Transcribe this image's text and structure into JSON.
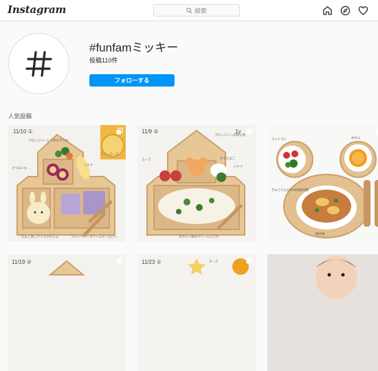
{
  "app": {
    "logo": "Instagram"
  },
  "search": {
    "placeholder": "検索"
  },
  "nav": {
    "icons": [
      "home-icon",
      "explore-icon",
      "heart-icon"
    ]
  },
  "hashtag": {
    "symbol": "#",
    "title": "#funfamミッキー",
    "post_count": "投稿110件",
    "follow_label": "フォローする"
  },
  "section": {
    "top_posts_label": "人気投稿"
  },
  "posts": [
    {
      "date": "11/10 ①",
      "notes": [
        "ブロッコリーと人参のサラダ",
        "さつまいも",
        "バナナ",
        "コーンスープ",
        "サツマイモ",
        "ミッキーパン",
        "たまご蒸しパンうさちゃん",
        "ブルーベリークリームチーズパン"
      ]
    },
    {
      "date": "11/9 ③",
      "notes": [
        "1y",
        "ブロッコリーの和え物",
        "スープ",
        "ゆでたまご",
        "ウインナー",
        "ホウレン草のクリームパスタ",
        "ミッキーライス",
        "バナナ"
      ]
    },
    {
      "date": "",
      "notes": [
        "ミニトマト",
        "みかん",
        "きゅうりとわかめの酢の物",
        "親子丼"
      ]
    },
    {
      "date": "11/19 ②",
      "notes": []
    },
    {
      "date": "11/23 ①",
      "notes": [
        "チーズ"
      ]
    },
    {
      "date": "",
      "notes": []
    }
  ],
  "colors": {
    "accent": "#0095f6",
    "border": "#dbdbdb",
    "muted": "#8e8e8e"
  }
}
